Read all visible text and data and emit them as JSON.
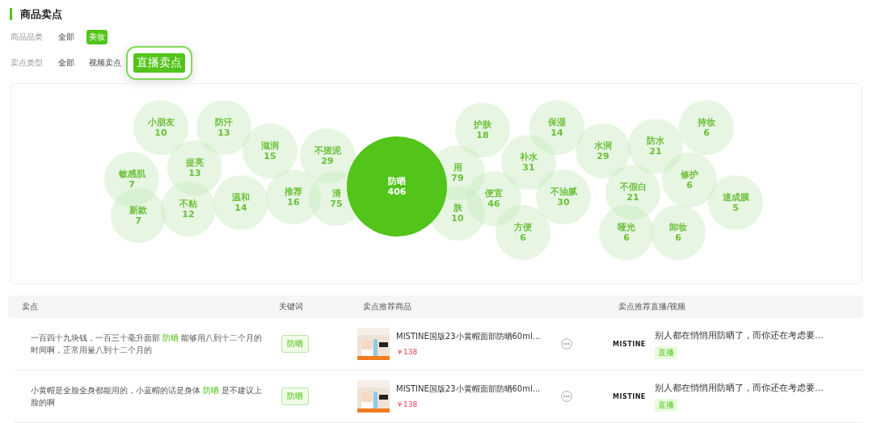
{
  "section_title": "商品卖点",
  "filters": [
    {
      "label": "商品品类",
      "options": [
        {
          "text": "全部",
          "selected": false
        },
        {
          "text": "美妆",
          "selected": true
        }
      ]
    },
    {
      "label": "卖点类型",
      "options": [
        {
          "text": "全部",
          "selected": false
        },
        {
          "text": "视频卖点",
          "selected": false
        },
        {
          "text": "直播卖点",
          "selected": true
        }
      ]
    }
  ],
  "bubbles": [
    {
      "label": "小朋友",
      "value": "10",
      "selected": false
    },
    {
      "label": "防汗",
      "value": "13",
      "selected": false
    },
    {
      "label": "滋润",
      "value": "15",
      "selected": false
    },
    {
      "label": "不搓泥",
      "value": "29",
      "selected": false
    },
    {
      "label": "敏感肌",
      "value": "7",
      "selected": false
    },
    {
      "label": "提亮",
      "value": "13",
      "selected": false
    },
    {
      "label": "新款",
      "value": "7",
      "selected": false
    },
    {
      "label": "不粘",
      "value": "12",
      "selected": false
    },
    {
      "label": "温和",
      "value": "14",
      "selected": false
    },
    {
      "label": "推荐",
      "value": "16",
      "selected": false
    },
    {
      "label": "清",
      "value": "75",
      "selected": false
    },
    {
      "label": "用",
      "value": "79",
      "selected": false
    },
    {
      "label": "肤",
      "value": "10",
      "selected": false
    },
    {
      "label": "护肤",
      "value": "18",
      "selected": false
    },
    {
      "label": "保湿",
      "value": "14",
      "selected": false
    },
    {
      "label": "补水",
      "value": "31",
      "selected": false
    },
    {
      "label": "便宜",
      "value": "46",
      "selected": false
    },
    {
      "label": "不油腻",
      "value": "30",
      "selected": false
    },
    {
      "label": "方便",
      "value": "6",
      "selected": false
    },
    {
      "label": "水润",
      "value": "29",
      "selected": false
    },
    {
      "label": "防水",
      "value": "21",
      "selected": false
    },
    {
      "label": "持妆",
      "value": "6",
      "selected": false
    },
    {
      "label": "修护",
      "value": "6",
      "selected": false
    },
    {
      "label": "不假白",
      "value": "21",
      "selected": false
    },
    {
      "label": "速成膜",
      "value": "5",
      "selected": false
    },
    {
      "label": "哑光",
      "value": "6",
      "selected": false
    },
    {
      "label": "卸妆",
      "value": "6",
      "selected": false
    },
    {
      "label": "防晒",
      "value": "406",
      "selected": true
    }
  ],
  "table": {
    "columns": [
      "卖点",
      "关键词",
      "卖点推荐商品",
      "卖点推荐直播/视频"
    ],
    "rows": [
      {
        "text_before": "一百四十九块钱，一百三十毫升面部",
        "keyword_in_text": "防晒",
        "text_after": "能够用八到十二个月的时间啊，正常用量八到十二个月的",
        "keyword": "防晒",
        "product_name": "MISTINE国版23小黄帽面部防晒60ml...",
        "price": "￥138",
        "brand": "MISTINE",
        "video_title": "别人都在悄悄用防晒了，而你还在考虑要...",
        "video_tag": "直播"
      },
      {
        "text_before": "小黄帽是全脸全身都能用的，小蓝帽的话是身体",
        "keyword_in_text": "防晒",
        "text_after": "是不建议上脸的啊",
        "keyword": "防晒",
        "product_name": "MISTINE国版23小黄帽面部防晒60ml...",
        "price": "￥138",
        "brand": "MISTINE",
        "video_title": "别人都在悄悄用防晒了，而你还在考虑要...",
        "video_tag": "直播"
      }
    ]
  }
}
